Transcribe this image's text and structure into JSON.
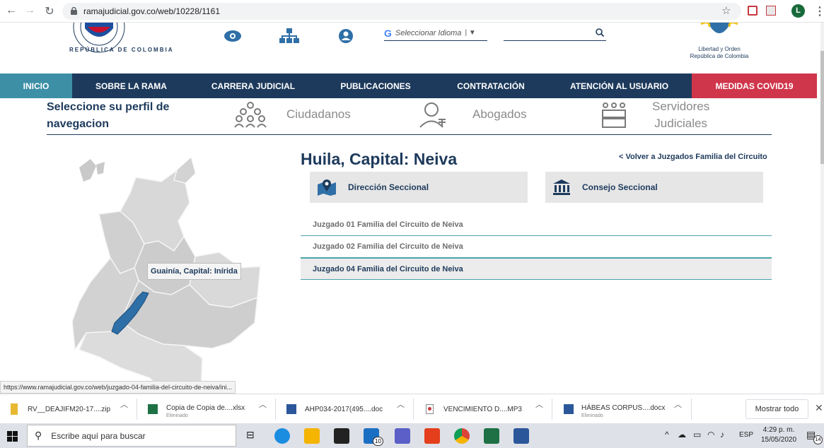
{
  "browser": {
    "url": "ramajudicial.gov.co/web/10228/1161",
    "profile_initial": "L"
  },
  "header": {
    "language_select": "Seleccionar Idioma",
    "search_placeholder": "",
    "logo_text": "REPÚBLICA DE COLOMBIA",
    "crest_line1": "Libertad y Orden",
    "crest_line2": "República de Colombia"
  },
  "nav": [
    {
      "label": "INICIO",
      "color": "#3d8fa6"
    },
    {
      "label": "SOBRE LA RAMA"
    },
    {
      "label": "CARRERA JUDICIAL"
    },
    {
      "label": "PUBLICACIONES"
    },
    {
      "label": "CONTRATACIÓN"
    },
    {
      "label": "ATENCIÓN AL USUARIO"
    },
    {
      "label": "MEDIDAS COVID19",
      "color": "#d0364b"
    }
  ],
  "profile": {
    "label_line1": "Seleccione su perfil de",
    "label_line2": "navegacion",
    "options": [
      "Ciudadanos",
      "Abogados"
    ],
    "servidores_line1": "Servidores",
    "servidores_line2": "Judiciales"
  },
  "map": {
    "tooltip": "Guainía, Capital: Inírida"
  },
  "main": {
    "title": "Huila, Capital: Neiva",
    "back_link": "< Volver a Juzgados Familia del Circuito",
    "btn_direccion": "Dirección Seccional",
    "btn_consejo": "Consejo Seccional",
    "courts": [
      "Juzgado 01 Familia del Circuito de Neiva",
      "Juzgado 02 Familia del Circuito de Neiva",
      "Juzgado 04 Familia del Circuito de Neiva"
    ]
  },
  "status_link": "https://www.ramajudicial.gov.co/web/juzgado-04-familia-del-circuito-de-neiva/ini...",
  "downloads": [
    {
      "name": "RV__DEAJIFM20-17....zip",
      "sub": ""
    },
    {
      "name": "Copia de Copia de....xlsx",
      "sub": "Eliminado"
    },
    {
      "name": "AHP034-2017(495....doc",
      "sub": ""
    },
    {
      "name": "VENCIMIENTO D....MP3",
      "sub": ""
    },
    {
      "name": "HÁBEAS CORPUS....docx",
      "sub": "Eliminado"
    }
  ],
  "downloads_show_all": "Mostrar todo",
  "taskbar": {
    "search_placeholder": "Escribe aquí para buscar",
    "mail_badge": "10",
    "lang": "ESP",
    "time": "4:29 p. m.",
    "date": "15/05/2020",
    "notif_count": "14"
  }
}
